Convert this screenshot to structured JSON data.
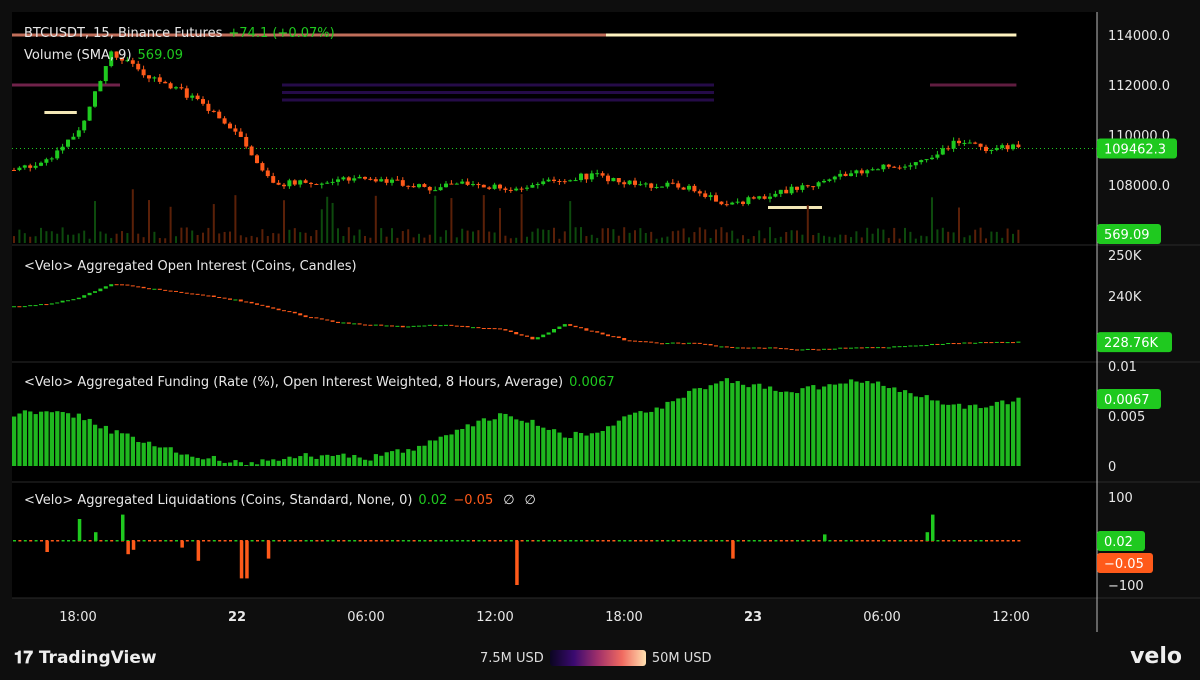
{
  "legend": {
    "main": {
      "title": "BTCUSDT, 15, Binance Futures",
      "change": "+74.1 (+0.07%)"
    },
    "volume": {
      "title": "Volume (SMA, 9)",
      "value": "569.09"
    },
    "oi": {
      "title": "<Velo> Aggregated Open Interest (Coins, Candles)"
    },
    "funding": {
      "title": "<Velo> Aggregated Funding (Rate (%), Open Interest Weighted, 8 Hours, Average)",
      "value": "0.0067"
    },
    "liq": {
      "title": "<Velo> Aggregated Liquidations (Coins, Standard, None, 0)",
      "long": "0.02",
      "short": "−0.05",
      "e1": "∅",
      "e2": "∅"
    }
  },
  "axes": {
    "price_ticks": [
      "114000.0",
      "112000.0",
      "110000.0",
      "108000.0"
    ],
    "price_tick_values": [
      114000,
      112000,
      110000,
      108000
    ],
    "price_label": "109462.3",
    "volume_label": "569.09",
    "volume_zero": "0",
    "oi_ticks": [
      "250K",
      "240K"
    ],
    "oi_tick_values": [
      250,
      240
    ],
    "oi_label": "228.76K",
    "funding_ticks": [
      "0.01",
      "0.005",
      "0"
    ],
    "funding_tick_values": [
      0.01,
      0.005,
      0
    ],
    "funding_label": "0.0067",
    "liq_ticks": [
      "100",
      "−100"
    ],
    "liq_tick_values": [
      100,
      -100
    ],
    "liq_long_label": "0.02",
    "liq_short_label": "−0.05",
    "time_ticks": [
      "18:00",
      "22",
      "06:00",
      "12:00",
      "18:00",
      "23",
      "06:00",
      "12:00"
    ]
  },
  "footer": {
    "brand": "TradingView",
    "scale_min": "7.5M USD",
    "scale_max": "50M USD",
    "logo": "velo"
  },
  "colors": {
    "up": "#1fc91f",
    "down": "#ff5a1a",
    "bg": "#000000",
    "label_green": "#1fc91f",
    "label_orange": "#ff5a1a"
  },
  "chart_data": {
    "type": "candlestick",
    "candles_per_sample": 6,
    "price_closes": [
      108600,
      109000,
      110200,
      113300,
      112400,
      111900,
      111000,
      109900,
      108100,
      108100,
      108200,
      108300,
      108100,
      107900,
      108100,
      107900,
      107900,
      108300,
      108400,
      108100,
      108000,
      107900,
      107200,
      107500,
      107800,
      108200,
      108500,
      108700,
      109000,
      109700,
      109500,
      109462.3
    ],
    "oi_closes_k": [
      237.5,
      238,
      239.5,
      243,
      242,
      241,
      240,
      238.8,
      237,
      235,
      233.5,
      233,
      232.5,
      233,
      232.5,
      232,
      229.5,
      233,
      231,
      229,
      228.5,
      228.5,
      227.5,
      227.5,
      227,
      227,
      227.5,
      227.5,
      228,
      228.5,
      228.7,
      228.76
    ],
    "funding": [
      0.0052,
      0.0055,
      0.005,
      0.0035,
      0.0025,
      0.0015,
      0.0008,
      0.0003,
      0.0005,
      0.001,
      0.001,
      0.0008,
      0.0015,
      0.0025,
      0.004,
      0.005,
      0.0045,
      0.003,
      0.0035,
      0.005,
      0.006,
      0.0075,
      0.0085,
      0.008,
      0.0075,
      0.008,
      0.0085,
      0.008,
      0.007,
      0.006,
      0.006,
      0.0067
    ],
    "liquidation_spikes": [
      [
        6,
        -25
      ],
      [
        12,
        50
      ],
      [
        15,
        20
      ],
      [
        20,
        60
      ],
      [
        21,
        -30
      ],
      [
        22,
        -20
      ],
      [
        31,
        -15
      ],
      [
        34,
        -45
      ],
      [
        42,
        -85
      ],
      [
        43,
        -85
      ],
      [
        47,
        -40
      ],
      [
        93,
        -100
      ],
      [
        133,
        -40
      ],
      [
        150,
        15
      ],
      [
        170,
        60
      ],
      [
        169,
        20
      ]
    ],
    "heatmap_levels": [
      {
        "price": 114000,
        "from": 110,
        "to": 186,
        "intensity": 1
      },
      {
        "price": 114000,
        "from": 0,
        "to": 110,
        "intensity": 0.8
      },
      {
        "price": 112000,
        "from": 0,
        "to": 20,
        "intensity": 0.7
      },
      {
        "price": 112000,
        "from": 170,
        "to": 186,
        "intensity": 0.6
      },
      {
        "price": 112000,
        "from": 50,
        "to": 130,
        "intensity": 0.3
      },
      {
        "price": 111700,
        "from": 50,
        "to": 130,
        "intensity": 0.25
      },
      {
        "price": 111400,
        "from": 50,
        "to": 130,
        "intensity": 0.2
      },
      {
        "price": 110900,
        "from": 6,
        "to": 12,
        "intensity": 0.95
      },
      {
        "price": 107100,
        "from": 140,
        "to": 150,
        "intensity": 0.95
      }
    ]
  }
}
